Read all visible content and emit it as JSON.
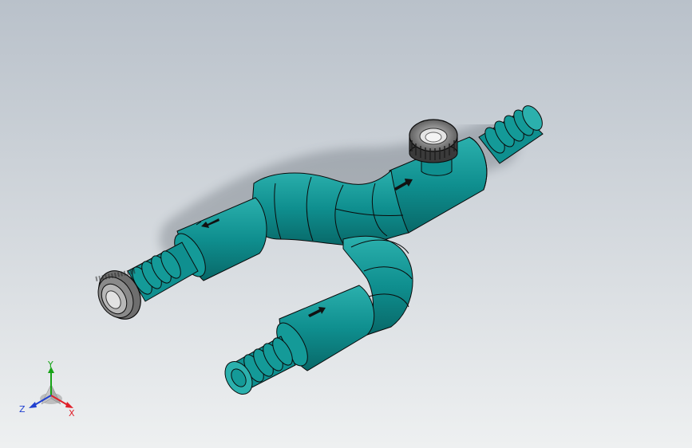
{
  "viewport": {
    "background_top": "#b9c1ca",
    "background_bottom": "#eef0f1"
  },
  "model": {
    "part_color": "#0f8f8f",
    "part_shade": "#0a6a6a",
    "part_highlight": "#33b5b2",
    "edge_color": "#0a0a0a",
    "nut_color": "#5a5a5a",
    "components": [
      {
        "name": "y-branch-body",
        "icon": "pipe"
      },
      {
        "name": "left-hose-barb",
        "icon": "barb"
      },
      {
        "name": "bottom-hose-barb",
        "icon": "barb"
      },
      {
        "name": "right-hose-barb",
        "icon": "barb"
      },
      {
        "name": "knurled-nut-end",
        "icon": "knurled-nut"
      },
      {
        "name": "knurled-cap-top",
        "icon": "knurled-cap"
      },
      {
        "name": "flow-arrow",
        "icon": "arrow"
      }
    ]
  },
  "triad": {
    "x_label": "X",
    "y_label": "Y",
    "z_label": "Z",
    "x_color": "#e0202a",
    "y_color": "#17a317",
    "z_color": "#2040d0"
  }
}
